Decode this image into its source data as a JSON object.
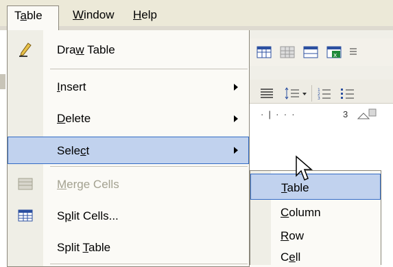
{
  "menubar": {
    "items": [
      "Table",
      "Window",
      "Help"
    ]
  },
  "table_menu": {
    "items": [
      {
        "label": "Draw Table",
        "icon": "pencil-icon",
        "has_submenu": false,
        "disabled": false
      },
      {
        "label": "Insert",
        "icon": null,
        "has_submenu": true,
        "disabled": false
      },
      {
        "label": "Delete",
        "icon": null,
        "has_submenu": true,
        "disabled": false
      },
      {
        "label": "Select",
        "icon": null,
        "has_submenu": true,
        "disabled": false,
        "highlighted": true
      },
      {
        "label": "Merge Cells",
        "icon": "merge-cells-icon",
        "has_submenu": false,
        "disabled": true
      },
      {
        "label": "Split Cells...",
        "icon": "split-cells-icon",
        "has_submenu": false,
        "disabled": false
      },
      {
        "label": "Split Table",
        "icon": null,
        "has_submenu": false,
        "disabled": false
      }
    ]
  },
  "select_submenu": {
    "items": [
      {
        "label": "Table",
        "highlighted": true
      },
      {
        "label": "Column"
      },
      {
        "label": "Row"
      },
      {
        "label": "Cell"
      }
    ]
  },
  "ruler": {
    "mark": "3"
  },
  "colors": {
    "highlight_fill": "#c1d2ee",
    "highlight_border": "#316ac5",
    "menu_bg": "#fbfaf6",
    "disabled_text": "#a3a190"
  }
}
